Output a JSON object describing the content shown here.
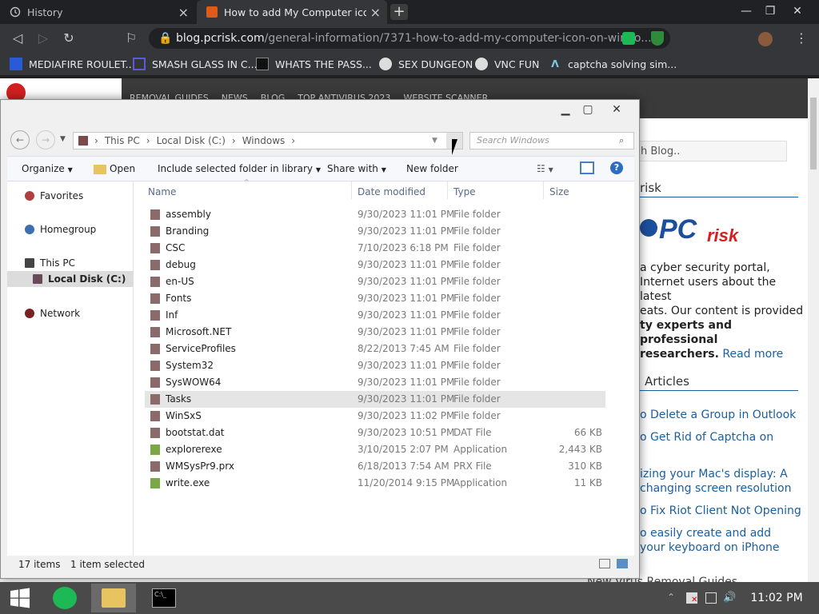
{
  "browser": {
    "tabs": [
      {
        "title": "History"
      },
      {
        "title": "How to add My Computer icon on"
      }
    ],
    "url": {
      "host": "blog.pcrisk.com",
      "path": "/general-information/7371-how-to-add-my-computer-icon-on-windo..."
    },
    "bookmarks": [
      {
        "label": "MEDIAFIRE ROULET..."
      },
      {
        "label": "SMASH GLASS IN C..."
      },
      {
        "label": "WHATS THE PASS..."
      },
      {
        "label": "SEX DUNGEON"
      },
      {
        "label": "VNC FUN"
      },
      {
        "label": "captcha solving sim..."
      }
    ]
  },
  "site": {
    "logo": "PC risk",
    "nav": [
      "REMOVAL GUIDES",
      "NEWS",
      "BLOG",
      "TOP ANTIVIRUS 2023",
      "WEBSITE SCANNER"
    ],
    "search_placeholder": "h Blog..",
    "about_heading": "risk",
    "about_lines": [
      "a cyber security portal,",
      "Internet users about the latest",
      "eats. Our content is provided",
      "ty experts and professional",
      "researchers."
    ],
    "read_more": "Read more",
    "articles_heading": "Articles",
    "articles": [
      "o Delete a Group in Outlook",
      "o Get Rid of Captcha on",
      "izing your Mac's display: A",
      "changing screen resolution",
      "o Fix Riot Client Not Opening",
      "o easily create and add",
      "your keyboard on iPhone"
    ],
    "new_guides": "New Virus Removal Guides"
  },
  "explorer": {
    "breadcrumb": [
      "This PC",
      "Local Disk (C:)",
      "Windows"
    ],
    "search_placeholder": "Search Windows",
    "commands": [
      "Organize",
      "Open",
      "Include selected folder in library",
      "Share with",
      "New folder"
    ],
    "nav_pane": {
      "favorites": "Favorites",
      "homegroup": "Homegroup",
      "this_pc": "This PC",
      "local_disk": "Local Disk (C:)",
      "network": "Network"
    },
    "columns": {
      "name": "Name",
      "date": "Date modified",
      "type": "Type",
      "size": "Size"
    },
    "rows": [
      {
        "name": "assembly",
        "date": "9/30/2023 11:01 PM",
        "type": "File folder",
        "size": ""
      },
      {
        "name": "Branding",
        "date": "9/30/2023 11:01 PM",
        "type": "File folder",
        "size": ""
      },
      {
        "name": "CSC",
        "date": "7/10/2023 6:18 PM",
        "type": "File folder",
        "size": ""
      },
      {
        "name": "debug",
        "date": "9/30/2023 11:01 PM",
        "type": "File folder",
        "size": ""
      },
      {
        "name": "en-US",
        "date": "9/30/2023 11:01 PM",
        "type": "File folder",
        "size": ""
      },
      {
        "name": "Fonts",
        "date": "9/30/2023 11:01 PM",
        "type": "File folder",
        "size": ""
      },
      {
        "name": "Inf",
        "date": "9/30/2023 11:01 PM",
        "type": "File folder",
        "size": ""
      },
      {
        "name": "Microsoft.NET",
        "date": "9/30/2023 11:01 PM",
        "type": "File folder",
        "size": ""
      },
      {
        "name": "ServiceProfiles",
        "date": "8/22/2013 7:45 AM",
        "type": "File folder",
        "size": ""
      },
      {
        "name": "System32",
        "date": "9/30/2023 11:01 PM",
        "type": "File folder",
        "size": ""
      },
      {
        "name": "SysWOW64",
        "date": "9/30/2023 11:01 PM",
        "type": "File folder",
        "size": ""
      },
      {
        "name": "Tasks",
        "date": "9/30/2023 11:01 PM",
        "type": "File folder",
        "size": ""
      },
      {
        "name": "WinSxS",
        "date": "9/30/2023 11:02 PM",
        "type": "File folder",
        "size": ""
      },
      {
        "name": "bootstat.dat",
        "date": "9/30/2023 10:51 PM",
        "type": "DAT File",
        "size": "66 KB"
      },
      {
        "name": "explorerexe",
        "date": "3/10/2015 2:07 PM",
        "type": "Application",
        "size": "2,443 KB"
      },
      {
        "name": "WMSysPr9.prx",
        "date": "6/18/2013 7:54 AM",
        "type": "PRX File",
        "size": "310 KB"
      },
      {
        "name": "write.exe",
        "date": "11/20/2014 9:15 PM",
        "type": "Application",
        "size": "11 KB"
      }
    ],
    "status": {
      "count": "17 items",
      "selected": "1 item selected"
    }
  },
  "taskbar": {
    "time": "11:02 PM"
  },
  "colors": {
    "accent": "#1a5fa0",
    "pcrisk_red": "#d32020",
    "pcrisk_blue": "#1c4f9c"
  }
}
